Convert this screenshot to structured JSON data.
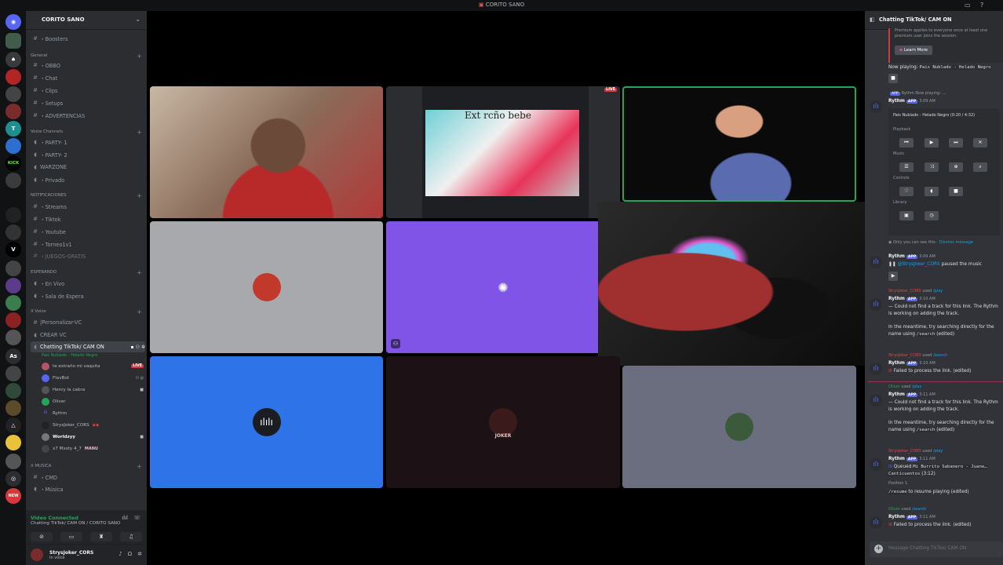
{
  "window": {
    "title": "CORITO SANO"
  },
  "server": {
    "name": "CORITO SANO"
  },
  "channels": {
    "boosters": "・Boosters",
    "cat_general": "General",
    "obbo": "・OBBO",
    "chat": "・Chat",
    "clips": "・Clips",
    "setups": "・Setups",
    "advertencias": "・ADVERTENCIAS",
    "cat_voice": "Voice Channels",
    "party1": "・PARTY- 1",
    "party2": "・PARTY- 2",
    "warzone": "WARZONE",
    "privado": "・Privado",
    "cat_notif": "NOTIFICACIONES",
    "streams": "・Streams",
    "tiktok": "・Tiktok",
    "youtube": "・Youtube",
    "torneo": "・Torneo1v1",
    "juegos": "・JUEGOS-GRATIS",
    "cat_esperando": "ESPERANDO",
    "envivo": "・En Vivo",
    "espera": "・Sala de Espera",
    "cat_xvoice": "X Voice",
    "personalizar": "|Personalizar-VC",
    "crear": "CREAR VC",
    "chatting": "Chatting TikTok/ CAM ON",
    "chatting_status": "Pais Nublado - Helado Negro",
    "cat_musica": "X MUSICA",
    "cmd": "・CMD",
    "musica": "・Música"
  },
  "voice_members": [
    {
      "name": "te extraño mi vaquita",
      "live": "LIVE"
    },
    {
      "name": "FlavBot"
    },
    {
      "name": "Henry la cabra"
    },
    {
      "name": "Oliver"
    },
    {
      "name": "Rythm"
    },
    {
      "name": "StrysJoker_CORS"
    },
    {
      "name": "Worldzyy"
    },
    {
      "name": "x7 Mxsty 4_7",
      "tag": "MANU"
    }
  ],
  "voice_panel": {
    "status": "Video Connected",
    "sub": "Chatting TikTok/ CAM ON / CORITO SANO"
  },
  "user": {
    "name": "StrysJoker_CORS",
    "status": "In voice"
  },
  "stage": {
    "screen_live_badge": "LIVE",
    "screen_overlay_text": "Ext rcño bebe",
    "joker_label": "JOKER"
  },
  "chat": {
    "header": "Chatting TikTok/ CAM ON",
    "premium_note": "Premium applies to everyone once at least one premium user joins the session.",
    "learn_more": "Learn More",
    "now_playing_label": "Now playing:",
    "now_playing_song": "Pais Nublado - Helado Negro",
    "reply_now_playing": "Rythm Now playing: ...",
    "bot_name": "Rythm",
    "app_badge": "APP",
    "time1": "3:09 AM",
    "track_progress": "Pais Nublado - Helado Negro (0:20 / 4:32)",
    "sec_playback": "Playback",
    "sec_music": "Music",
    "sec_controls": "Controls",
    "sec_library": "Library",
    "only_you": "Only you can see this ·",
    "dismiss": "Dismiss message",
    "time2": "3:09 AM",
    "paused_user": "@StrysJoker_CORS",
    "paused_text": "paused the music",
    "m3_user": "StrysJoker_CORS",
    "used": "used",
    "play_cmd": "play",
    "search_cmd": "search",
    "time3": "3:10 AM",
    "not_found_1": "Could not find a track for this link. The Rythm",
    "not_found_2": "is working on adding the track.",
    "meantime_1": "In the meantime, try searching directly for the",
    "meantime_2": "name using",
    "search_slash": "/search",
    "edited": "(edited)",
    "failed": "Failed to process the link.",
    "oliver": "Oliver",
    "time4": "3:11 AM",
    "queued_label": "Queued",
    "queued_song": "Mi Burrito Sabanero - Juane…",
    "queued_song2": "Canticuentos",
    "queued_dur": "(3:12)",
    "position": "Position 1",
    "resume_cmd": "/resume",
    "resume_text": "to resume playing",
    "input_placeholder": "Message Chatting TikTok/ CAM ON"
  },
  "colors": {
    "accent": "#5865f2",
    "sidebar": "#2b2d31",
    "guildbar": "#111214",
    "chat_bg": "#313338",
    "tile_purple": "#8054e6",
    "tile_blue": "#2f73e8",
    "tile_gray": "#6b6e7f",
    "tile_dark": "#1c1216",
    "live_red": "#da373c",
    "online_green": "#23a55a"
  }
}
